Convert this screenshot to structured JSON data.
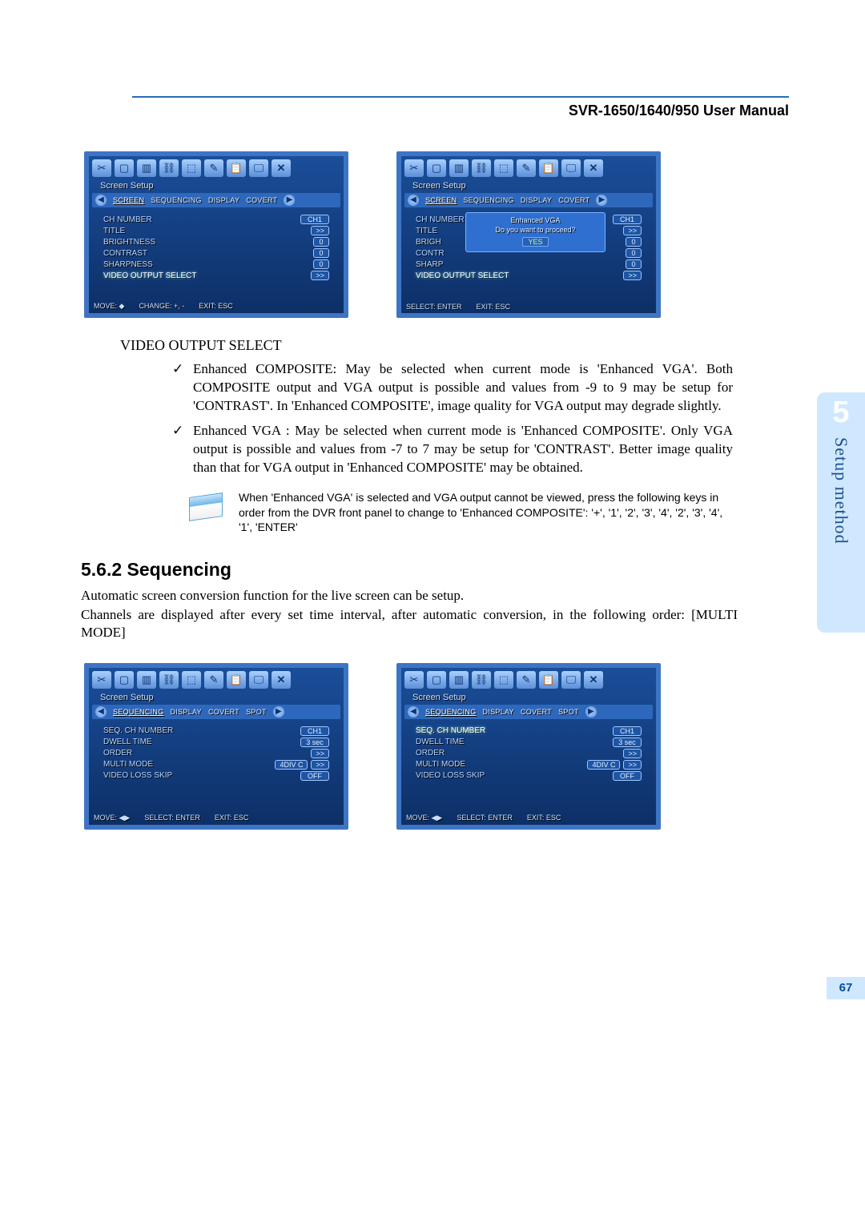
{
  "header": {
    "title": "SVR-1650/1640/950 User Manual"
  },
  "side_tab": {
    "chapter_num": "5",
    "label": "Setup method"
  },
  "page_number": "67",
  "screen1": {
    "panel_title": "Screen Setup",
    "tabs": [
      "SCREEN",
      "SEQUENCING",
      "DISPLAY",
      "COVERT"
    ],
    "rows": [
      {
        "label": "CH NUMBER",
        "value": "CH1"
      },
      {
        "label": "TITLE",
        "value": ">>"
      },
      {
        "label": "BRIGHTNESS",
        "value": "0"
      },
      {
        "label": "CONTRAST",
        "value": "0"
      },
      {
        "label": "SHARPNESS",
        "value": "0"
      },
      {
        "label": "VIDEO OUTPUT SELECT",
        "value": ">>",
        "hl": true
      }
    ],
    "footer": [
      "MOVE: ◆",
      "CHANGE: +, -",
      "EXIT: ESC"
    ]
  },
  "screen2": {
    "panel_title": "Screen Setup",
    "tabs": [
      "SCREEN",
      "SEQUENCING",
      "DISPLAY",
      "COVERT"
    ],
    "rows": [
      {
        "label": "CH NUMBER",
        "value": "CH1"
      },
      {
        "label": "TITLE",
        "value": ">>"
      },
      {
        "label": "BRIGH",
        "value": "0"
      },
      {
        "label": "CONTR",
        "value": "0"
      },
      {
        "label": "SHARP",
        "value": "0"
      },
      {
        "label": "VIDEO OUTPUT SELECT",
        "value": ">>",
        "hl": true
      }
    ],
    "popup": {
      "title": "Enhanced VGA",
      "message": "Do you want to proceed?",
      "button": "YES"
    },
    "footer": [
      "SELECT: ENTER",
      "EXIT: ESC"
    ]
  },
  "section_label": "VIDEO OUTPUT SELECT",
  "bullets": [
    "Enhanced COMPOSITE: May be selected when current mode is 'Enhanced VGA'. Both COMPOSITE output and VGA output is possible and values from -9 to 9 may be setup for 'CONTRAST'. In 'Enhanced COMPOSITE', image quality for VGA output may degrade slightly.",
    "Enhanced VGA : May be selected when current mode is 'Enhanced COMPOSITE'. Only VGA output is possible and values from -7 to 7 may be setup for 'CONTRAST'. Better image quality than that for VGA output in 'Enhanced COMPOSITE' may be obtained."
  ],
  "note_text": "When 'Enhanced VGA' is selected and VGA output cannot be viewed, press the following keys in order from the DVR front panel to change to 'Enhanced COMPOSITE':  '+', '1', '2', '3', '4', '2', '3', '4', '1', 'ENTER'",
  "subsec_heading": "5.6.2 Sequencing",
  "body_paragraphs": [
    "Automatic screen conversion function for the live screen can be setup.",
    "Channels are displayed after every set time interval, after automatic conversion, in the following order: [MULTI MODE]"
  ],
  "screen3": {
    "panel_title": "Screen Setup",
    "tabs": [
      "SEQUENCING",
      "DISPLAY",
      "COVERT",
      "SPOT"
    ],
    "rows": [
      {
        "label": "SEQ. CH NUMBER",
        "value": "CH1"
      },
      {
        "label": "DWELL TIME",
        "value": "3 sec"
      },
      {
        "label": "ORDER",
        "value": ">>"
      },
      {
        "label": "MULTI MODE",
        "value": "4DIV C",
        "extra": ">>"
      },
      {
        "label": "VIDEO LOSS SKIP",
        "value": "OFF"
      }
    ],
    "footer": [
      "MOVE: ◀▶",
      "SELECT: ENTER",
      "EXIT: ESC"
    ]
  },
  "screen4": {
    "panel_title": "Screen Setup",
    "tabs": [
      "SEQUENCING",
      "DISPLAY",
      "COVERT",
      "SPOT"
    ],
    "rows": [
      {
        "label": "SEQ. CH NUMBER",
        "value": "CH1",
        "hl": true
      },
      {
        "label": "DWELL TIME",
        "value": "3 sec"
      },
      {
        "label": "ORDER",
        "value": ">>"
      },
      {
        "label": "MULTI MODE",
        "value": "4DIV C",
        "extra": ">>"
      },
      {
        "label": "VIDEO LOSS SKIP",
        "value": "OFF"
      }
    ],
    "footer": [
      "MOVE: ◀▶",
      "SELECT: ENTER",
      "EXIT: ESC"
    ]
  },
  "icons": [
    "✂",
    "▢",
    "▥",
    "⛓",
    "⬚",
    "✎",
    "📋",
    "🖵",
    "✕"
  ]
}
